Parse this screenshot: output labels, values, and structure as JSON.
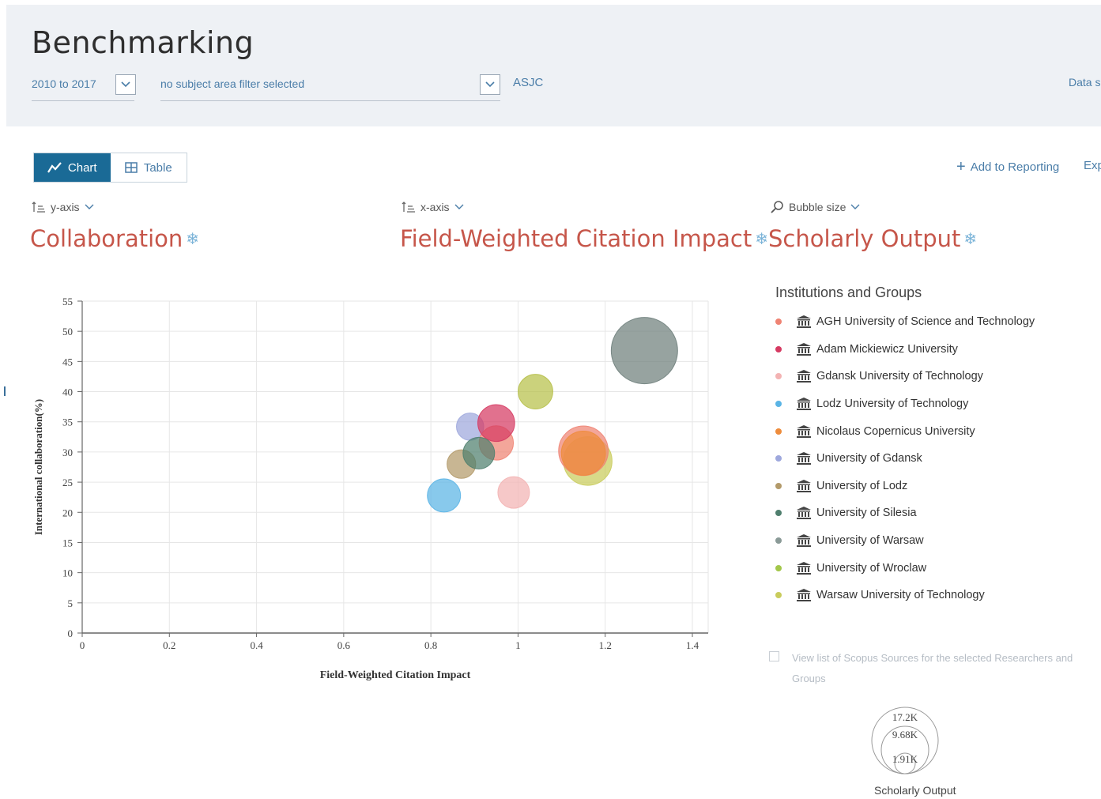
{
  "header": {
    "title": "Benchmarking",
    "date_range": "2010 to 2017",
    "subject_filter": "no subject area filter selected",
    "asjc_link": "ASJC",
    "data_source_link": "Data s"
  },
  "view_toggle": {
    "chart_label": "Chart",
    "table_label": "Table",
    "active": "Chart"
  },
  "actions": {
    "add_to_reporting": "Add to Reporting",
    "export_label": "Exp"
  },
  "selectors": {
    "y_axis": {
      "label": "y-axis",
      "metric": "Collaboration"
    },
    "x_axis": {
      "label": "x-axis",
      "metric": "Field-Weighted Citation Impact"
    },
    "bubble": {
      "label": "Bubble size",
      "metric": "Scholarly Output"
    }
  },
  "legend": {
    "title": "Institutions and Groups",
    "items": [
      {
        "name": "AGH University of Science and Technology",
        "color": "#ef8373"
      },
      {
        "name": "Adam Mickiewicz University",
        "color": "#d63a62"
      },
      {
        "name": "Gdansk University of Technology",
        "color": "#f3b3b3"
      },
      {
        "name": "Lodz University of Technology",
        "color": "#5ab4e5"
      },
      {
        "name": "Nicolaus Copernicus University",
        "color": "#ee8c3c"
      },
      {
        "name": "University of Gdansk",
        "color": "#9ea8dd"
      },
      {
        "name": "University of Lodz",
        "color": "#b39a6a"
      },
      {
        "name": "University of Silesia",
        "color": "#4f7f6e"
      },
      {
        "name": "University of Warsaw",
        "color": "#8a9a97"
      },
      {
        "name": "University of Wroclaw",
        "color": "#a3c74a"
      },
      {
        "name": "Warsaw University of Technology",
        "color": "#c9cc5c"
      }
    ]
  },
  "view_list_text": "View list of Scopus Sources for the selected Researchers and Groups",
  "bubble_key": {
    "large": "17.2K",
    "medium": "9.68K",
    "small": "1.91K",
    "caption": "Scholarly Output"
  },
  "chart_data": {
    "type": "scatter",
    "xlabel": "Field-Weighted Citation Impact",
    "ylabel": "International collaboration(%)",
    "xlim": [
      0,
      1.4
    ],
    "ylim": [
      0,
      55
    ],
    "xticks": [
      "0",
      "0.2",
      "0.4",
      "0.6",
      "0.8",
      "1",
      "1.2",
      "1.4"
    ],
    "yticks": [
      "0",
      "5",
      "10",
      "15",
      "20",
      "25",
      "30",
      "35",
      "40",
      "45",
      "50",
      "55"
    ],
    "grid": true,
    "points": [
      {
        "name": "University of Warsaw",
        "x": 1.29,
        "y": 46.8,
        "size": 17200,
        "color": "#6f7f7c"
      },
      {
        "name": "Warsaw University of Technology",
        "x": 1.16,
        "y": 28.5,
        "size": 9200,
        "color": "#c9cc5c"
      },
      {
        "name": "AGH University of Science and Technology",
        "x": 1.15,
        "y": 30.2,
        "size": 9600,
        "color": "#ef8373"
      },
      {
        "name": "Nicolaus Copernicus University",
        "x": 1.15,
        "y": 29.8,
        "size": 7600,
        "color": "#ee8c3c"
      },
      {
        "name": "University of Wroclaw",
        "x": 1.04,
        "y": 40.0,
        "size": 4700,
        "color": "#b7c04a"
      },
      {
        "name": "Gdansk University of Technology",
        "x": 0.99,
        "y": 23.3,
        "size": 3900,
        "color": "#f3b3b3"
      },
      {
        "name": "University of Gdansk",
        "x": 0.89,
        "y": 34.2,
        "size": 2900,
        "color": "#9ea8dd"
      },
      {
        "name": "University of Lodz",
        "x": 0.87,
        "y": 28.0,
        "size": 3200,
        "color": "#b39a6a"
      },
      {
        "name": "Lodz University of Technology",
        "x": 0.83,
        "y": 22.8,
        "size": 4300,
        "color": "#5ab4e5"
      },
      {
        "name": "Adam Mickiewicz University",
        "x": 0.95,
        "y": 31.5,
        "size": 4600,
        "color": "#ef8373"
      },
      {
        "name": "Adam Mickiewicz University",
        "x": 0.95,
        "y": 34.8,
        "size": 5300,
        "color": "#d63a62"
      },
      {
        "name": "University of Silesia",
        "x": 0.91,
        "y": 29.8,
        "size": 3900,
        "color": "#4f7f6e"
      }
    ]
  }
}
